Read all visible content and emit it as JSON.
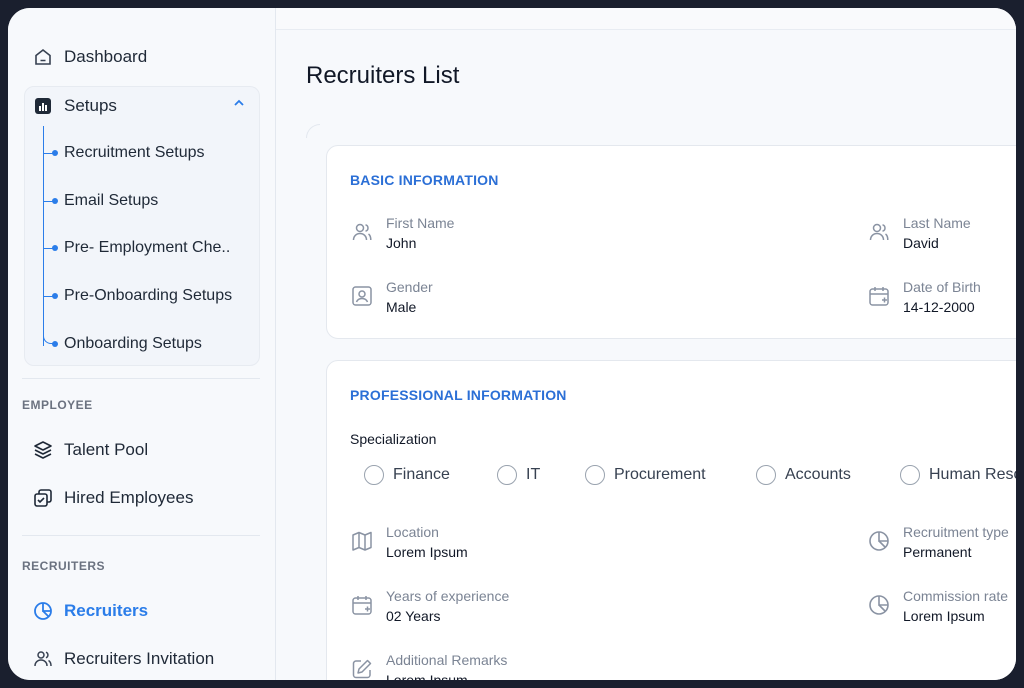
{
  "sidebar": {
    "dashboard": "Dashboard",
    "setups": "Setups",
    "setup_items": [
      "Recruitment Setups",
      "Email Setups",
      "Pre- Employment Che..",
      "Pre-Onboarding Setups",
      "Onboarding Setups"
    ],
    "employee_section": "EMPLOYEE",
    "talent_pool": "Talent Pool",
    "hired_employees": "Hired Employees",
    "recruiters_section": "RECRUITERS",
    "recruiters": "Recruiters",
    "recruiters_invitation": "Recruiters Invitation"
  },
  "main": {
    "title": "Recruiters List",
    "basic": {
      "title": "BASIC INFORMATION",
      "first_name_label": "First Name",
      "first_name": "John",
      "last_name_label": "Last Name",
      "last_name": "David",
      "gender_label": "Gender",
      "gender": "Male",
      "dob_label": "Date of Birth",
      "dob": "14-12-2000"
    },
    "professional": {
      "title": "PROFESSIONAL INFORMATION",
      "specialization_label": "Specialization",
      "options": [
        "Finance",
        "IT",
        "Procurement",
        "Accounts",
        "Human Resources"
      ],
      "location_label": "Location",
      "location": "Lorem Ipsum",
      "recruitment_type_label": "Recruitment type",
      "recruitment_type": "Permanent",
      "experience_label": "Years of experience",
      "experience": "02 Years",
      "commission_label": "Commission rate",
      "commission": "Lorem Ipsum",
      "remarks_label": "Additional Remarks",
      "remarks": "Lorem Ipsum"
    }
  },
  "colors": {
    "accent": "#2b7de9",
    "heading_blue": "#2b6fd6"
  }
}
